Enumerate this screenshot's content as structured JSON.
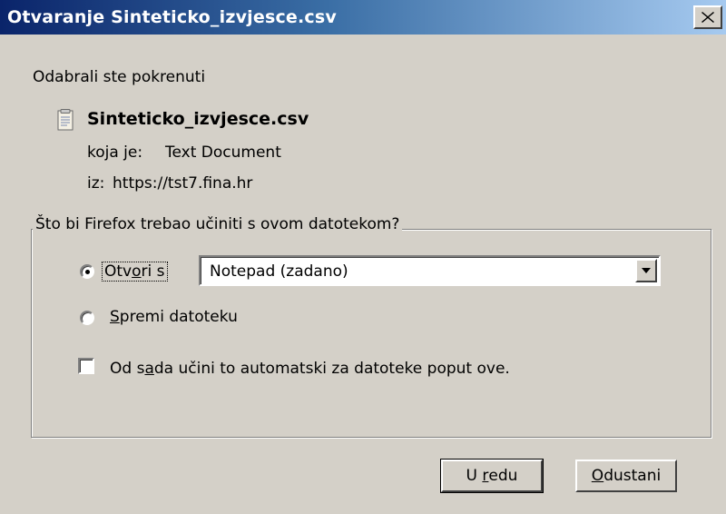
{
  "dialog": {
    "title": "Otvaranje Sinteticko_izvjesce.csv",
    "intro": "Odabrali ste pokrenuti",
    "file_name": "Sinteticko_izvjesce.csv",
    "type_label": "koja je:",
    "type_value": "Text Document",
    "from_label": "iz:",
    "from_value": "https://tst7.fina.hr"
  },
  "action_group": {
    "legend": "Što bi Firefox trebao učiniti s ovom datotekom?",
    "open_with": {
      "label_prefix": "Otv",
      "label_accel": "o",
      "label_suffix": "ri s",
      "selected": true
    },
    "app_select": {
      "value": "Notepad (zadano)"
    },
    "save_file": {
      "label_accel": "S",
      "label_suffix": "premi datoteku",
      "selected": false
    },
    "auto_checkbox": {
      "label_prefix": "Od s",
      "label_accel": "a",
      "label_suffix": "da učini to automatski za datoteke poput ove.",
      "checked": false
    }
  },
  "buttons": {
    "ok_prefix": "U ",
    "ok_accel": "r",
    "ok_suffix": "edu",
    "cancel_accel": "O",
    "cancel_suffix": "dustani"
  },
  "icons": {
    "close": "close-icon",
    "file": "text-document-icon",
    "dropdown": "chevron-down-icon"
  }
}
